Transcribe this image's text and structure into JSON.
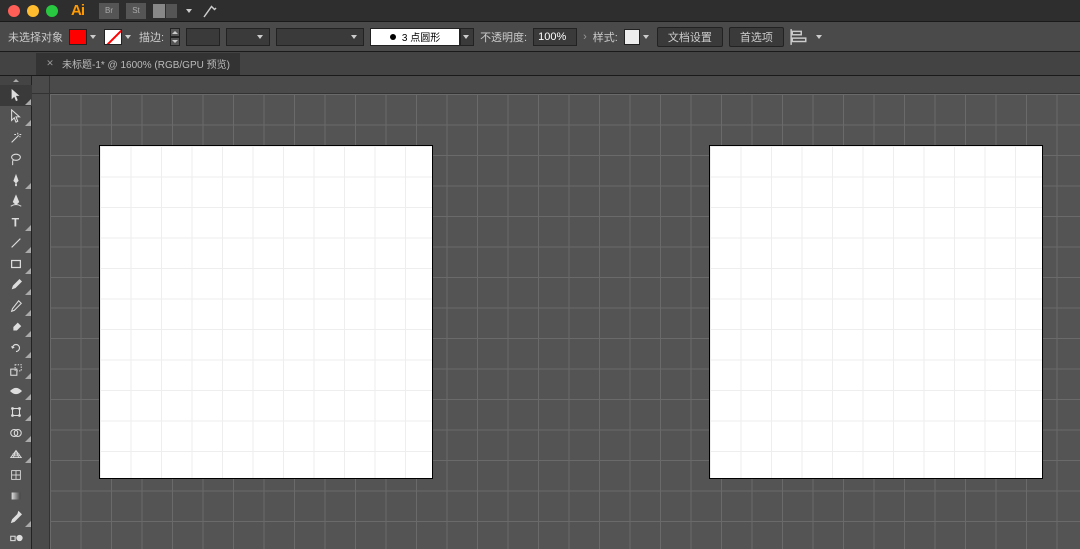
{
  "titlebar": {
    "app_name": "Ai",
    "panel_br_label": "Br",
    "panel_st_label": "St"
  },
  "controlbar": {
    "no_selection_label": "未选择对象",
    "stroke_label": "描边:",
    "stroke_weight": "",
    "brush_profile_label": "3 点圆形",
    "opacity_label": "不透明度:",
    "opacity_value": "100%",
    "style_label": "样式:",
    "doc_setup_label": "文档设置",
    "prefs_label": "首选项"
  },
  "tab": {
    "title": "未标题-1* @ 1600% (RGB/GPU 预览)"
  },
  "tools": [
    {
      "name": "selection-tool"
    },
    {
      "name": "direct-selection-tool"
    },
    {
      "name": "magic-wand-tool"
    },
    {
      "name": "lasso-tool"
    },
    {
      "name": "pen-tool"
    },
    {
      "name": "curvature-tool"
    },
    {
      "name": "type-tool"
    },
    {
      "name": "line-tool"
    },
    {
      "name": "rectangle-tool"
    },
    {
      "name": "paintbrush-tool"
    },
    {
      "name": "pencil-tool"
    },
    {
      "name": "eraser-tool"
    },
    {
      "name": "rotate-tool"
    },
    {
      "name": "scale-tool"
    },
    {
      "name": "width-tool"
    },
    {
      "name": "free-transform-tool"
    },
    {
      "name": "shape-builder-tool"
    },
    {
      "name": "perspective-grid-tool"
    },
    {
      "name": "mesh-tool"
    },
    {
      "name": "gradient-tool"
    },
    {
      "name": "eyedropper-tool"
    },
    {
      "name": "blend-tool"
    }
  ]
}
